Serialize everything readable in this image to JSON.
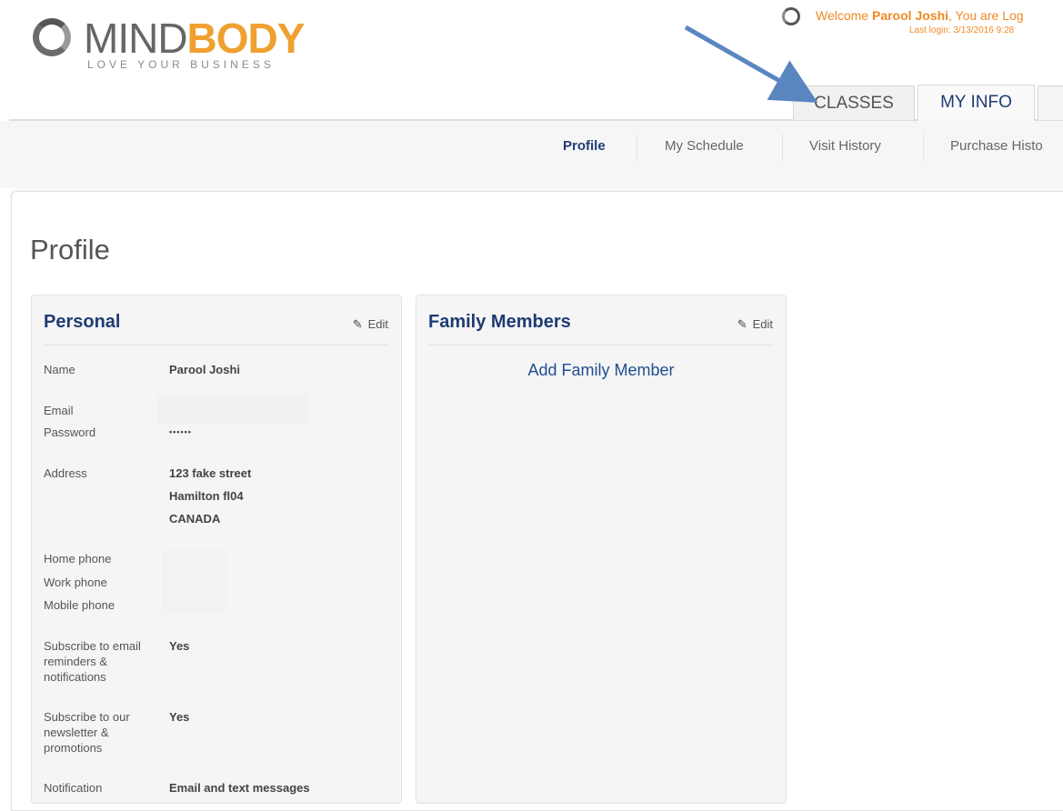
{
  "logo": {
    "word_part1": "MIND",
    "word_part2": "BODY",
    "tagline": "LOVE YOUR BUSINESS"
  },
  "header": {
    "welcome_prefix": "Welcome ",
    "user_name": "Parool Joshi",
    "welcome_suffix": ", You are Log",
    "last_login": "Last login: 3/13/2016 9:28"
  },
  "tabs": {
    "classes": "CLASSES",
    "myinfo": "MY INFO"
  },
  "subnav": {
    "profile": "Profile",
    "schedule": "My Schedule",
    "visit": "Visit History",
    "purchase": "Purchase Histo"
  },
  "page_title": "Profile",
  "personal": {
    "title": "Personal",
    "edit_label": "Edit",
    "name_label": "Name",
    "name_value": "Parool Joshi",
    "email_label": "Email",
    "password_label": "Password",
    "password_value": "••••••",
    "address_label": "Address",
    "address_line1": "123 fake street",
    "address_line2": "Hamilton fl04",
    "address_line3": "CANADA",
    "home_phone_label": "Home phone",
    "work_phone_label": "Work phone",
    "mobile_phone_label": "Mobile phone",
    "subscribe_email_label": "Subscribe to email reminders & notifications",
    "subscribe_email_value": "Yes",
    "subscribe_news_label": "Subscribe to our newsletter & promotions",
    "subscribe_news_value": "Yes",
    "notification_label": "Notification",
    "notification_value": "Email and text messages"
  },
  "family": {
    "title": "Family Members",
    "edit_label": "Edit",
    "add_link": "Add Family Member"
  },
  "colors": {
    "brand_orange": "#f0a030",
    "nav_blue": "#1f3c73",
    "link_blue": "#1f4f8f",
    "arrow_blue": "#5a86c0"
  }
}
